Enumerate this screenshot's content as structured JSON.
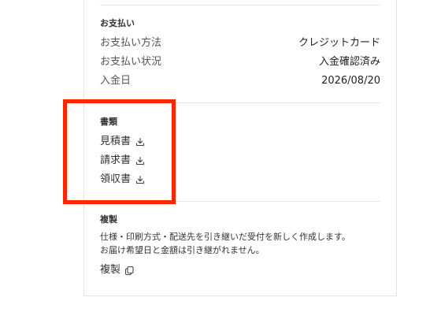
{
  "payment": {
    "title": "お支払い",
    "rows": [
      {
        "label": "お支払い方法",
        "value": "クレジットカード"
      },
      {
        "label": "お支払い状況",
        "value": "入金確認済み"
      },
      {
        "label": "入金日",
        "value": "2026/08/20"
      }
    ]
  },
  "documents": {
    "title": "書類",
    "items": [
      {
        "label": "見積書",
        "icon": "download-icon"
      },
      {
        "label": "請求書",
        "icon": "download-icon"
      },
      {
        "label": "領収書",
        "icon": "download-icon"
      }
    ]
  },
  "duplicate": {
    "title": "複製",
    "description_line1": "仕様・印刷方式・配送先を引き継いだ受付を新しく作成します。",
    "description_line2": "お届け希望日と金額は引き継がれません。",
    "link_label": "複製",
    "icon": "copy-icon"
  },
  "colors": {
    "highlight": "#ff2600",
    "border": "#e3e3e3",
    "text": "#333333"
  }
}
